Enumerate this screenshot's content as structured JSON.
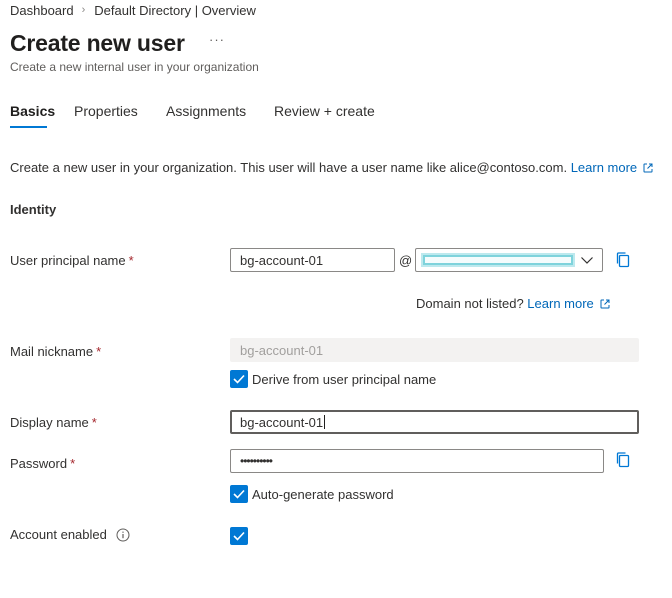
{
  "breadcrumb": [
    {
      "label": "Dashboard"
    },
    {
      "label": "Default Directory | Overview"
    }
  ],
  "breadcrumb_separator": "›",
  "page": {
    "title": "Create new user",
    "more_label": "···",
    "subtitle": "Create a new internal user in your organization"
  },
  "tabs": [
    {
      "label": "Basics",
      "active": true
    },
    {
      "label": "Properties",
      "active": false
    },
    {
      "label": "Assignments",
      "active": false
    },
    {
      "label": "Review + create",
      "active": false
    }
  ],
  "intro": {
    "text": "Create a new user in your organization. This user will have a user name like alice@contoso.com.",
    "link": "Learn more"
  },
  "identity": {
    "title": "Identity",
    "required_marker": "*",
    "upn": {
      "label": "User principal name",
      "value": "bg-account-01",
      "at": "@",
      "domain_value": ""
    },
    "domain_note": {
      "text": "Domain not listed?",
      "link": "Learn more"
    },
    "mail_nickname": {
      "label": "Mail nickname",
      "value": "bg-account-01",
      "derive_label": "Derive from user principal name",
      "derive_checked": true
    },
    "display_name": {
      "label": "Display name",
      "value": "bg-account-01"
    },
    "password": {
      "label": "Password",
      "value": "••••••••••",
      "autogen_label": "Auto-generate password",
      "autogen_checked": true
    },
    "account_enabled": {
      "label": "Account enabled",
      "checked": true
    }
  },
  "icons": {
    "copy": "copy-icon",
    "external": "external-link-icon",
    "chevron": "chevron-down-icon",
    "info": "info-icon",
    "check": "checkmark-icon"
  },
  "colors": {
    "accent": "#0078d4",
    "link": "#0067b8",
    "required": "#a4262c",
    "text": "#323130"
  }
}
